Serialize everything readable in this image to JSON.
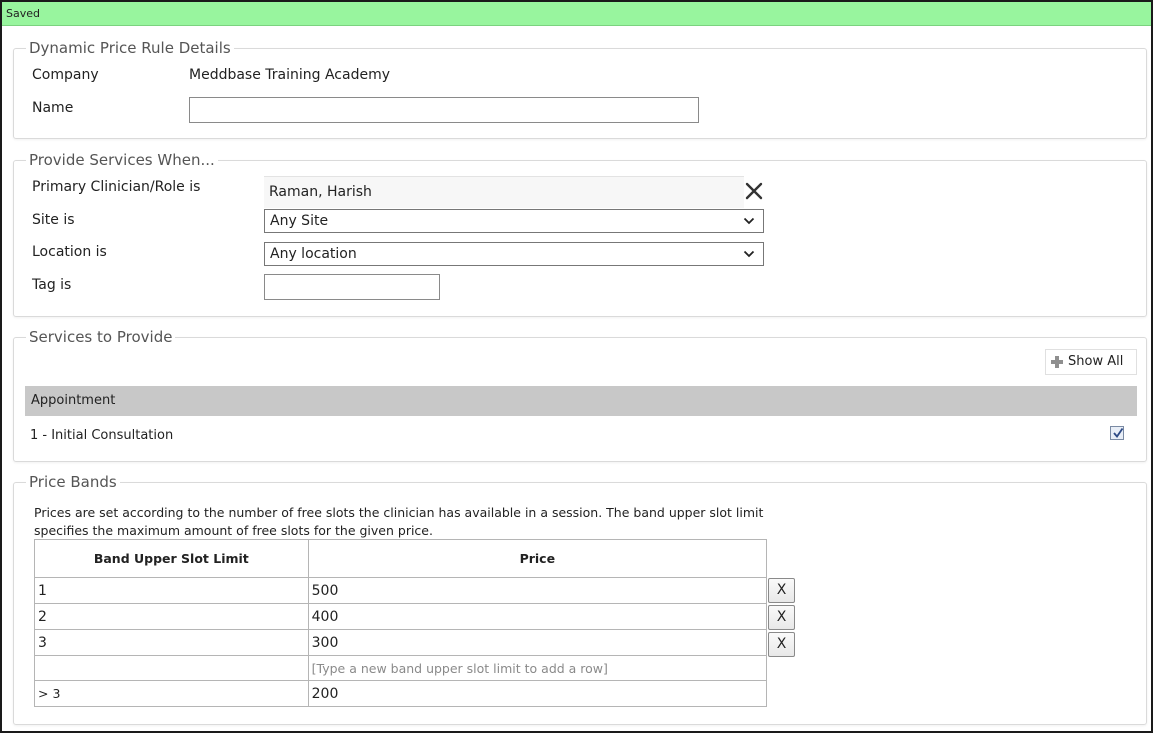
{
  "status": {
    "text": "Saved",
    "color": "#98f59e"
  },
  "details": {
    "legend": "Dynamic Price Rule Details",
    "company_label": "Company",
    "company_value": "Meddbase Training Academy",
    "name_label": "Name",
    "name_value": ""
  },
  "provide": {
    "legend": "Provide Services When...",
    "clinician_label": "Primary Clinician/Role is",
    "clinician_value": "Raman, Harish",
    "site_label": "Site is",
    "site_value": "Any Site",
    "location_label": "Location is",
    "location_value": "Any location",
    "tag_label": "Tag is",
    "tag_value": ""
  },
  "services": {
    "legend": "Services to Provide",
    "show_all_label": "Show All",
    "group_header": "Appointment",
    "items": [
      {
        "label": "1 - Initial Consultation",
        "checked": true
      }
    ]
  },
  "bands": {
    "legend": "Price Bands",
    "description": "Prices are set according to the number of free slots the clinician has available in a session. The band upper slot limit specifies the maximum amount of free slots for the given price.",
    "col_limit": "Band Upper Slot Limit",
    "col_price": "Price",
    "rows": [
      {
        "limit": "1",
        "price": "500",
        "delete_label": "X"
      },
      {
        "limit": "2",
        "price": "400",
        "delete_label": "X"
      },
      {
        "limit": "3",
        "price": "300",
        "delete_label": "X"
      }
    ],
    "new_row_hint": "[Type a new band upper slot limit to add a row]",
    "final_row": {
      "limit": "> 3",
      "price": "200"
    }
  }
}
